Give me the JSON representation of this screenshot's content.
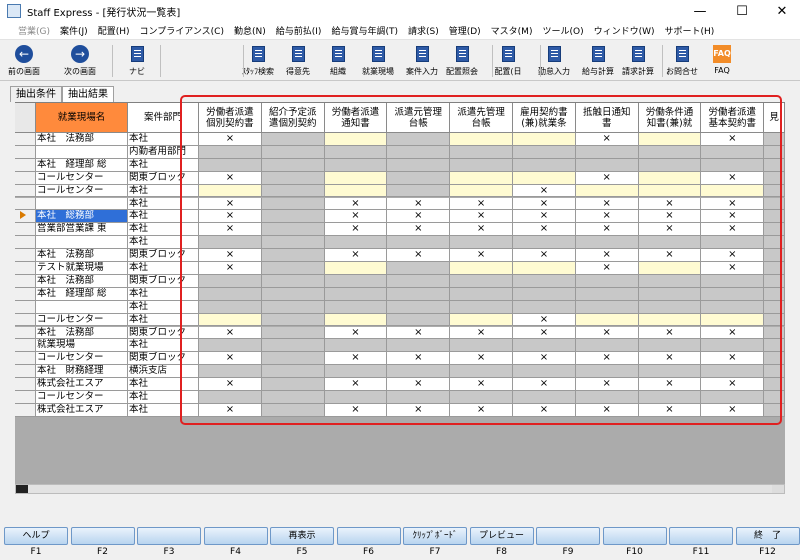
{
  "window": {
    "title": "Staff Express - [発行状況一覧表]",
    "min": "—",
    "max": "☐",
    "close": "✕"
  },
  "menu": [
    {
      "label": "営業(G)",
      "disabled": true
    },
    {
      "label": "案件(J)"
    },
    {
      "label": "配置(H)"
    },
    {
      "label": "コンプライアンス(C)"
    },
    {
      "label": "勤怠(N)"
    },
    {
      "label": "給与前払(I)"
    },
    {
      "label": "給与賞与年調(T)"
    },
    {
      "label": "請求(S)"
    },
    {
      "label": "管理(D)"
    },
    {
      "label": "マスタ(M)"
    },
    {
      "label": "ツール(O)"
    },
    {
      "label": "ウィンドウ(W)"
    },
    {
      "label": "サポート(H)"
    }
  ],
  "toolbar": {
    "back": "前の画面",
    "next": "次の画面",
    "navi": "ナビ",
    "items": [
      "ｽﾀｯﾌ検索",
      "得意先",
      "組織",
      "就業現場",
      "案件入力",
      "配置照会",
      "配置(日",
      "勤怠入力",
      "給与計算",
      "請求計算",
      "お問合せ",
      "FAQ"
    ],
    "arrow_left": "←",
    "arrow_right": "→",
    "faq_icon_text": "FAQ"
  },
  "tabs": [
    "抽出条件",
    "抽出結果"
  ],
  "grid": {
    "col_headers": [
      "就業現場名",
      "案件部門",
      "労働者派遣\n個別契約書",
      "紹介予定派\n遣個別契約",
      "労働者派遣\n通知書",
      "派遣元管理\n台帳",
      "派遣先管理\n台帳",
      "雇用契約書\n(兼)就業条",
      "抵触日通知\n書",
      "労働条件通\n知書(兼)就",
      "労働者派遣\n基本契約書",
      "見"
    ],
    "mark": "×",
    "rows": [
      {
        "site": "本社　法務部",
        "dept": "本社",
        "marks": [
          1,
          0,
          0,
          0,
          0,
          0,
          1,
          0,
          1
        ]
      },
      {
        "site": "",
        "dept": "内勤者用部門",
        "marks": [
          0,
          0,
          0,
          0,
          0,
          0,
          0,
          0,
          0
        ]
      },
      {
        "site": "本社　経理部 総",
        "dept": "本社",
        "marks": [
          0,
          0,
          0,
          0,
          0,
          0,
          0,
          0,
          0
        ]
      },
      {
        "site": "コールセンター",
        "dept": "関東ブロック",
        "marks": [
          1,
          0,
          0,
          0,
          0,
          0,
          1,
          0,
          1
        ]
      },
      {
        "site": "コールセンター",
        "dept": "本社",
        "marks": [
          0,
          0,
          0,
          0,
          0,
          1,
          0,
          0,
          0
        ]
      },
      {
        "site": "",
        "dept": "本社",
        "marks": [
          1,
          0,
          1,
          1,
          1,
          1,
          1,
          1,
          1
        ]
      },
      {
        "site": "本社　総務部",
        "dept": "本社",
        "marks": [
          1,
          0,
          1,
          1,
          1,
          1,
          1,
          1,
          1
        ],
        "selected": true
      },
      {
        "site": "営業部営業課 東",
        "dept": "本社",
        "marks": [
          1,
          0,
          1,
          1,
          1,
          1,
          1,
          1,
          1
        ]
      },
      {
        "site": "",
        "dept": "本社",
        "marks": [
          0,
          0,
          0,
          0,
          0,
          0,
          0,
          0,
          0
        ]
      },
      {
        "site": "本社　法務部",
        "dept": "関東ブロック",
        "marks": [
          1,
          0,
          1,
          1,
          1,
          1,
          1,
          1,
          1
        ]
      },
      {
        "site": "テスト就業現場",
        "dept": "本社",
        "marks": [
          1,
          0,
          0,
          0,
          0,
          0,
          1,
          0,
          1
        ]
      },
      {
        "site": "本社　法務部",
        "dept": "関東ブロック",
        "marks": [
          0,
          0,
          0,
          0,
          0,
          0,
          0,
          0,
          0
        ]
      },
      {
        "site": "本社　経理部 総",
        "dept": "本社",
        "marks": [
          0,
          0,
          0,
          0,
          0,
          0,
          0,
          0,
          0
        ]
      },
      {
        "site": "",
        "dept": "本社",
        "marks": [
          0,
          0,
          0,
          0,
          0,
          0,
          0,
          0,
          0
        ]
      },
      {
        "site": "コールセンター",
        "dept": "本社",
        "marks": [
          0,
          0,
          0,
          0,
          0,
          1,
          0,
          0,
          0
        ]
      },
      {
        "site": "本社　法務部",
        "dept": "関東ブロック",
        "marks": [
          1,
          0,
          1,
          1,
          1,
          1,
          1,
          1,
          1
        ]
      },
      {
        "site": "就業現場",
        "dept": "本社",
        "marks": [
          0,
          0,
          0,
          0,
          0,
          0,
          0,
          0,
          0
        ]
      },
      {
        "site": "コールセンター",
        "dept": "関東ブロック",
        "marks": [
          1,
          0,
          1,
          1,
          1,
          1,
          1,
          1,
          1
        ]
      },
      {
        "site": "本社　財務経理",
        "dept": "横浜支店",
        "marks": [
          0,
          0,
          0,
          0,
          0,
          0,
          0,
          0,
          0
        ]
      },
      {
        "site": "株式会社エスア",
        "dept": "本社",
        "marks": [
          1,
          0,
          1,
          1,
          1,
          1,
          1,
          1,
          1
        ]
      },
      {
        "site": "コールセンター",
        "dept": "本社",
        "marks": [
          0,
          0,
          0,
          0,
          0,
          0,
          0,
          0,
          0
        ]
      },
      {
        "site": "株式会社エスア",
        "dept": "本社",
        "marks": [
          1,
          0,
          1,
          1,
          1,
          1,
          1,
          1,
          1
        ]
      }
    ]
  },
  "fkeys": [
    {
      "key": "F1",
      "label": "ヘルプ"
    },
    {
      "key": "F2",
      "label": ""
    },
    {
      "key": "F3",
      "label": ""
    },
    {
      "key": "F4",
      "label": ""
    },
    {
      "key": "F5",
      "label": "再表示"
    },
    {
      "key": "F6",
      "label": ""
    },
    {
      "key": "F7",
      "label": "ｸﾘｯﾌﾟﾎﾞｰﾄﾞ"
    },
    {
      "key": "F8",
      "label": "プレビュー"
    },
    {
      "key": "F9",
      "label": ""
    },
    {
      "key": "F10",
      "label": ""
    },
    {
      "key": "F11",
      "label": ""
    },
    {
      "key": "F12",
      "label": "終　了"
    }
  ],
  "colors": {
    "accent_header": "#ff8a3c",
    "cell_yellow": "#fffbd2",
    "cell_gray": "#c8c8c8",
    "cell_white": "#ffffff",
    "selected": "#2f6fd8",
    "highlight": "#e02020"
  }
}
